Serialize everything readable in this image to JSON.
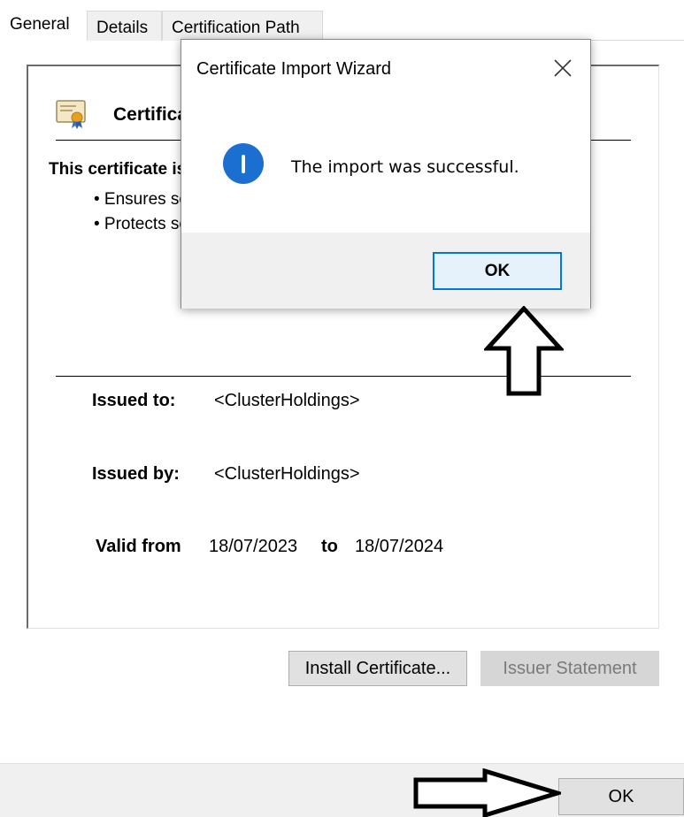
{
  "tabs": [
    {
      "label": "General",
      "active": true
    },
    {
      "label": "Details",
      "active": false
    },
    {
      "label": "Certification Path",
      "active": false
    }
  ],
  "certificate": {
    "title": "Certificate Information",
    "description": "This certificate is intended for the following purpose(s):",
    "bullets": [
      "• Ensures software came from software publisher",
      "• Protects software from alteration after publication"
    ],
    "issued_to_label": "Issued to:",
    "issued_to_value": "<ClusterHoldings>",
    "issued_by_label": "Issued by:",
    "issued_by_value": "<ClusterHoldings>",
    "valid_from_label": "Valid from",
    "valid_from_value": "18/07/2023",
    "valid_to_label": "to",
    "valid_to_value": "18/07/2024"
  },
  "buttons": {
    "install": "Install Certificate...",
    "issuer_statement": "Issuer Statement",
    "ok": "OK"
  },
  "dialog": {
    "title": "Certificate Import Wizard",
    "message": "The import was successful.",
    "ok": "OK",
    "icon": "info-icon"
  },
  "colors": {
    "accent": "#0078d7",
    "info_icon": "#1a6fd0"
  }
}
